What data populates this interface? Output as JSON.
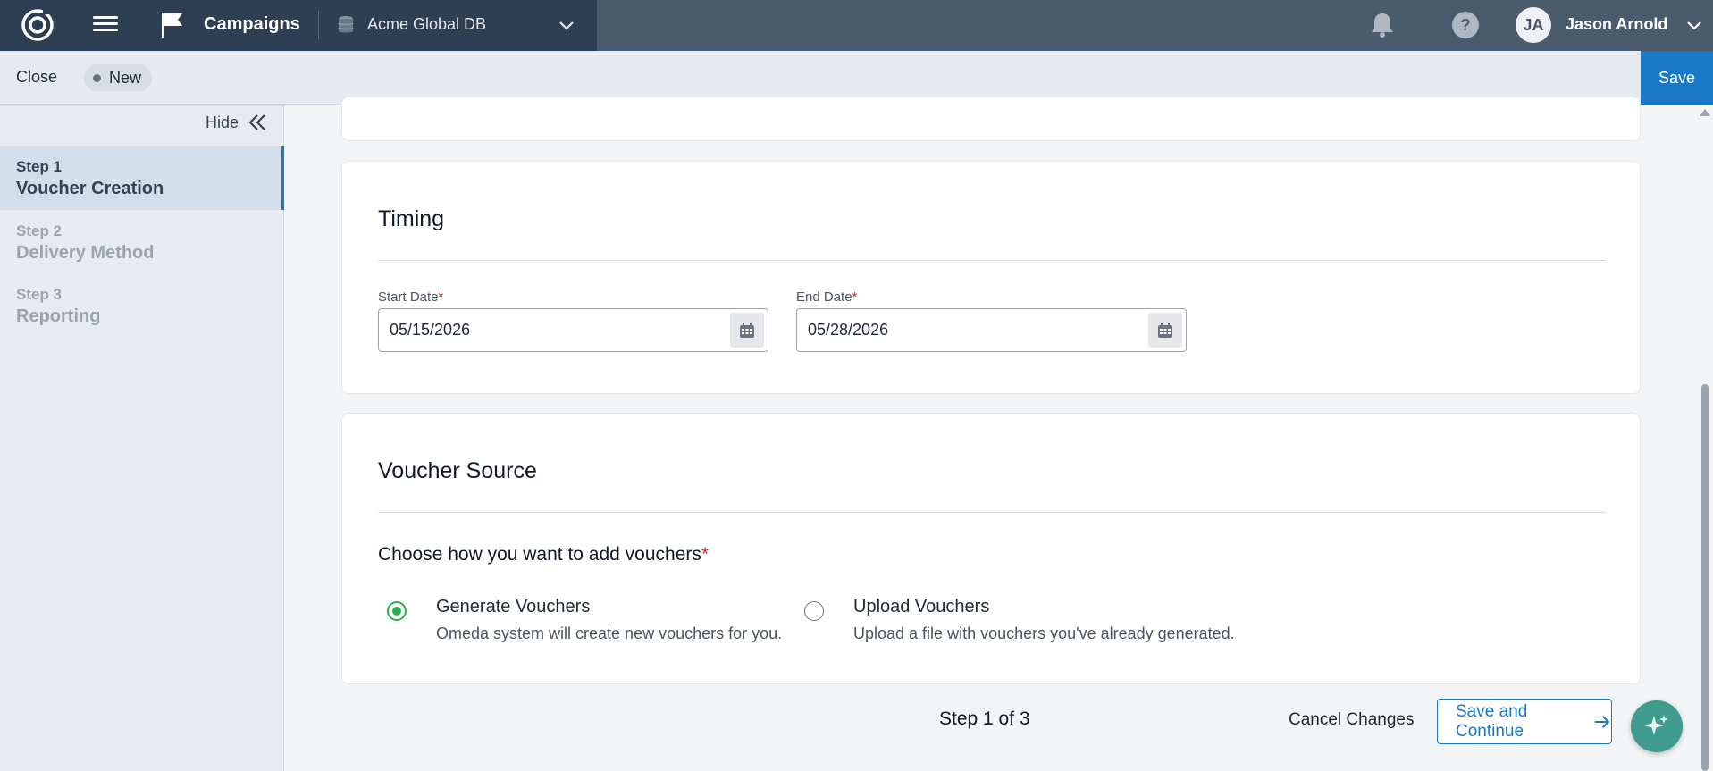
{
  "topnav": {
    "app_title": "Campaigns",
    "database": "Acme Global DB",
    "user_initials": "JA",
    "user_name": "Jason Arnold",
    "icons": [
      "logo-icon",
      "hamburger-icon",
      "flag-icon",
      "database-icon",
      "chevron-down-icon",
      "bell-icon",
      "help-icon"
    ]
  },
  "actionbar": {
    "close_label": "Close",
    "status": "New",
    "save_label": "Save"
  },
  "sidebar": {
    "hide_label": "Hide",
    "steps": [
      {
        "num": "Step 1",
        "title": "Voucher Creation",
        "active": true
      },
      {
        "num": "Step 2",
        "title": "Delivery Method",
        "active": false
      },
      {
        "num": "Step 3",
        "title": "Reporting",
        "active": false
      }
    ]
  },
  "timing": {
    "title": "Timing",
    "start_label": "Start Date",
    "start_value": "05/15/2026",
    "end_label": "End Date",
    "end_value": "05/28/2026",
    "required_mark": "*"
  },
  "voucher_source": {
    "title": "Voucher Source",
    "prompt": "Choose how you want to add vouchers",
    "required_mark": "*",
    "options": [
      {
        "title": "Generate Vouchers",
        "desc": "Omeda system will create new vouchers for you.",
        "selected": true
      },
      {
        "title": "Upload Vouchers",
        "desc": "Upload a file with vouchers you've already generated.",
        "selected": false
      }
    ]
  },
  "footer": {
    "step_indicator": "Step 1 of 3",
    "cancel_label": "Cancel Changes",
    "continue_label": "Save and Continue"
  },
  "colors": {
    "primary": "#1a78c8",
    "nav_dark": "#2f3f53",
    "nav": "#4b5b6e",
    "radio_selected": "#22b24c",
    "required": "#dc2626"
  }
}
